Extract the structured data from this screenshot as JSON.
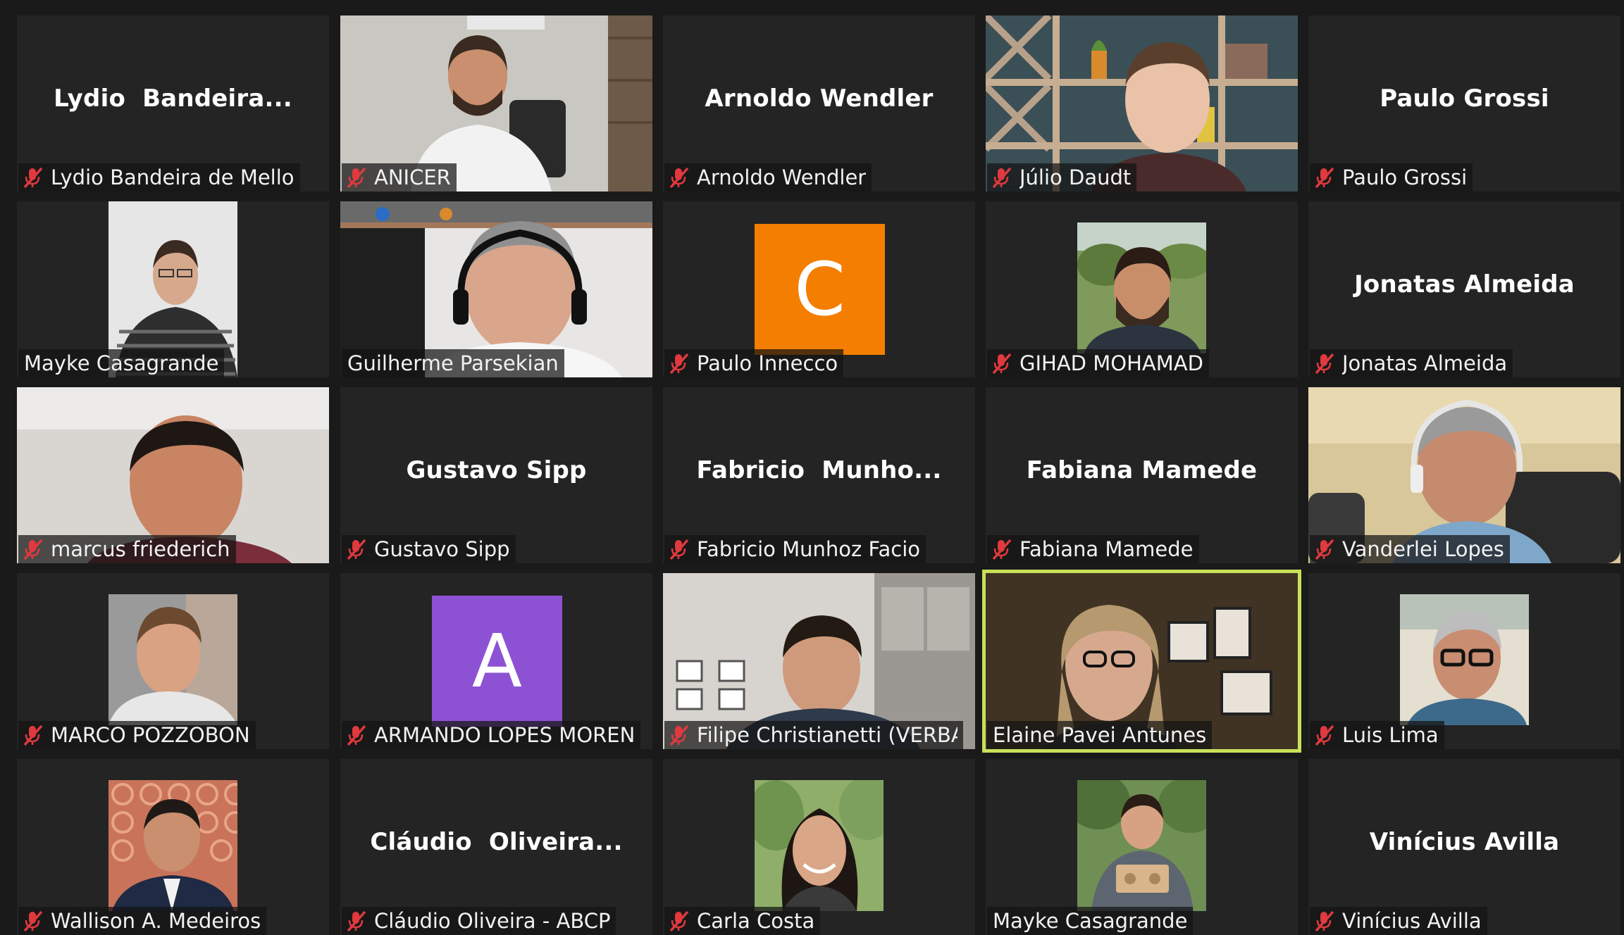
{
  "meeting": {
    "view": "Gallery View",
    "active_speaker": "Elaine Pavei Antunes"
  },
  "colors": {
    "tile_bg": "#242424",
    "active_border": "#c8e05a",
    "muted_icon": "#e0393e",
    "avatar_orange": "#f37e00",
    "avatar_purple": "#8d52d4"
  },
  "participants": [
    {
      "display": "Lydio  Bandeira...",
      "label": "Lydio Bandeira de Mello",
      "muted": true,
      "video": false
    },
    {
      "display": "",
      "label": "ANICER",
      "muted": true,
      "video": true
    },
    {
      "display": "Arnoldo Wendler",
      "label": "Arnoldo Wendler",
      "muted": true,
      "video": false
    },
    {
      "display": "",
      "label": "Júlio Daudt",
      "muted": true,
      "video": true
    },
    {
      "display": "Paulo Grossi",
      "label": "Paulo Grossi",
      "muted": true,
      "video": false
    },
    {
      "display": "",
      "label": "Mayke Casagrande",
      "muted": false,
      "video": true
    },
    {
      "display": "",
      "label": "Guilherme Parsekian",
      "muted": false,
      "video": true
    },
    {
      "display": "",
      "label": "Paulo Innecco",
      "muted": true,
      "video": false,
      "avatar_letter": "C"
    },
    {
      "display": "",
      "label": "GIHAD MOHAMAD",
      "muted": true,
      "video": true
    },
    {
      "display": "Jonatas Almeida",
      "label": "Jonatas Almeida",
      "muted": true,
      "video": false
    },
    {
      "display": "",
      "label": "marcus friederich",
      "muted": true,
      "video": true
    },
    {
      "display": "Gustavo Sipp",
      "label": "Gustavo Sipp",
      "muted": true,
      "video": false
    },
    {
      "display": "Fabricio  Munho...",
      "label": "Fabricio Munhoz Facio",
      "muted": true,
      "video": false
    },
    {
      "display": "Fabiana Mamede",
      "label": "Fabiana Mamede",
      "muted": true,
      "video": false
    },
    {
      "display": "",
      "label": "Vanderlei Lopes",
      "muted": true,
      "video": true
    },
    {
      "display": "",
      "label": "MARCO POZZOBON",
      "muted": true,
      "video": true
    },
    {
      "display": "",
      "label": "ARMANDO LOPES MOREN...",
      "muted": true,
      "video": false,
      "avatar_letter": "A"
    },
    {
      "display": "",
      "label": "Filipe Christianetti (VERBA...",
      "muted": true,
      "video": true
    },
    {
      "display": "",
      "label": "Elaine Pavei Antunes",
      "muted": false,
      "video": true,
      "active": true
    },
    {
      "display": "",
      "label": "Luis Lima",
      "muted": true,
      "video": true
    },
    {
      "display": "",
      "label": "Wallison A. Medeiros",
      "muted": true,
      "video": true
    },
    {
      "display": "Cláudio  Oliveira...",
      "label": "Cláudio Oliveira - ABCP",
      "muted": true,
      "video": false
    },
    {
      "display": "",
      "label": "Carla Costa",
      "muted": true,
      "video": true
    },
    {
      "display": "",
      "label": "Mayke Casagrande",
      "muted": false,
      "video": true
    },
    {
      "display": "Vinícius Avilla",
      "label": "Vinícius Avilla",
      "muted": true,
      "video": false
    }
  ]
}
